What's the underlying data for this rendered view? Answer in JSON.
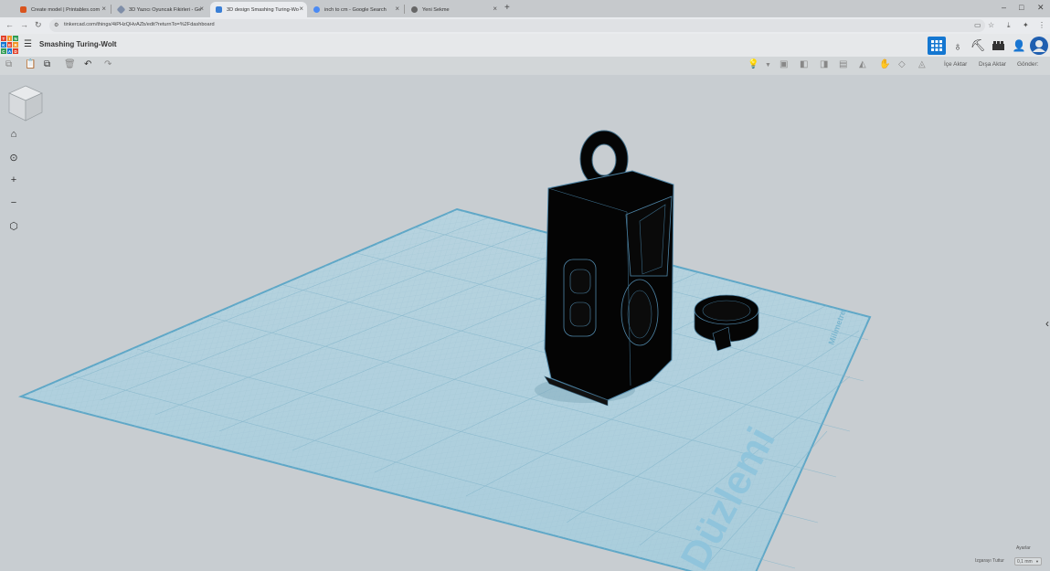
{
  "browser": {
    "tabs": [
      {
        "title": "Create model | Printables.com",
        "favicon_color": "#d9541e"
      },
      {
        "title": "3D Yazıcı Oyuncak Fikirleri - Ge",
        "favicon_color": "#7f8ea8"
      },
      {
        "title": "3D design Smashing Turing-Wo",
        "favicon_color": "#3a7fd6"
      },
      {
        "title": "inch to cm - Google Search",
        "favicon_color": "#4a8af4"
      },
      {
        "title": "Yeni Sekme",
        "favicon_color": "#666666"
      }
    ],
    "active_tab": 2,
    "url": "tinkercad.com/things/4iPHzQHvAZb/edit?returnTo=%2Fdashboard",
    "window_controls": [
      "minimize-icon",
      "maximize-icon",
      "close-icon"
    ]
  },
  "app": {
    "logo_letters": [
      "T",
      "I",
      "N",
      "K",
      "E",
      "R",
      "C",
      "A",
      "D"
    ],
    "design_title": "Smashing Turing-Wolt",
    "accent_color": "#1477d1"
  },
  "toolbar": {
    "import_label": "İçe Aktar",
    "export_label": "Dışa Aktar",
    "send_label": "Gönder:"
  },
  "workplane": {
    "label": "Düzlemi",
    "units_label": "Milimetre",
    "settings_label": "Ayarlar",
    "snap_label": "Izgarayı Tuttur",
    "snap_value": "0,1 mm"
  }
}
